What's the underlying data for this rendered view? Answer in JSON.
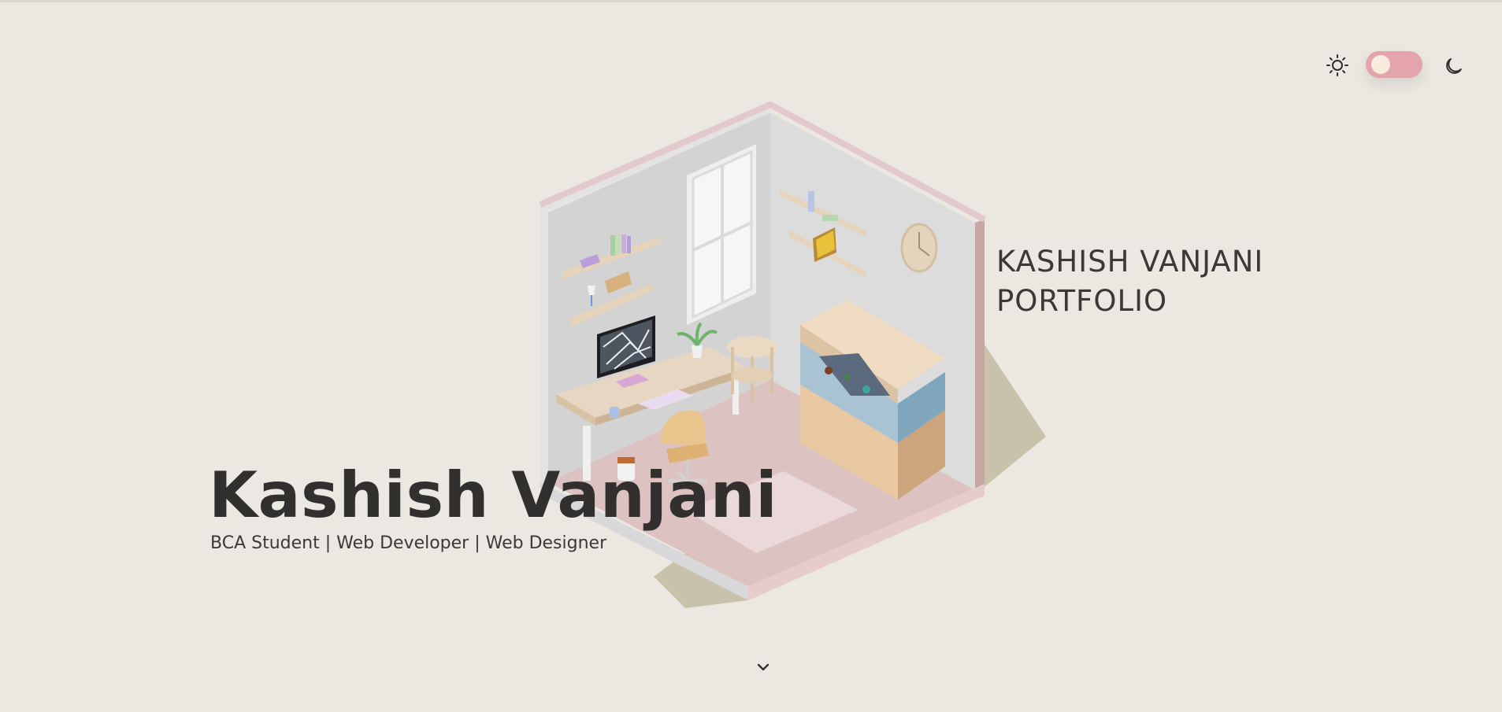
{
  "theme_toggle": {
    "light_icon": "sun-icon",
    "dark_icon": "moon-icon",
    "state": "light",
    "track_color": "#e4a4ab",
    "knob_color": "#f7ecdd"
  },
  "side_title": {
    "line1": "KASHISH VANJANI",
    "line2": "PORTFOLIO"
  },
  "hero": {
    "name": "Kashish Vanjani",
    "subtitle": "BCA Student | Web Developer | Web Designer"
  },
  "scroll_indicator": {
    "icon": "chevron-down-icon"
  },
  "colors": {
    "background": "#ebe8e1",
    "text": "#333231",
    "accent_pink": "#e4a4ab"
  }
}
